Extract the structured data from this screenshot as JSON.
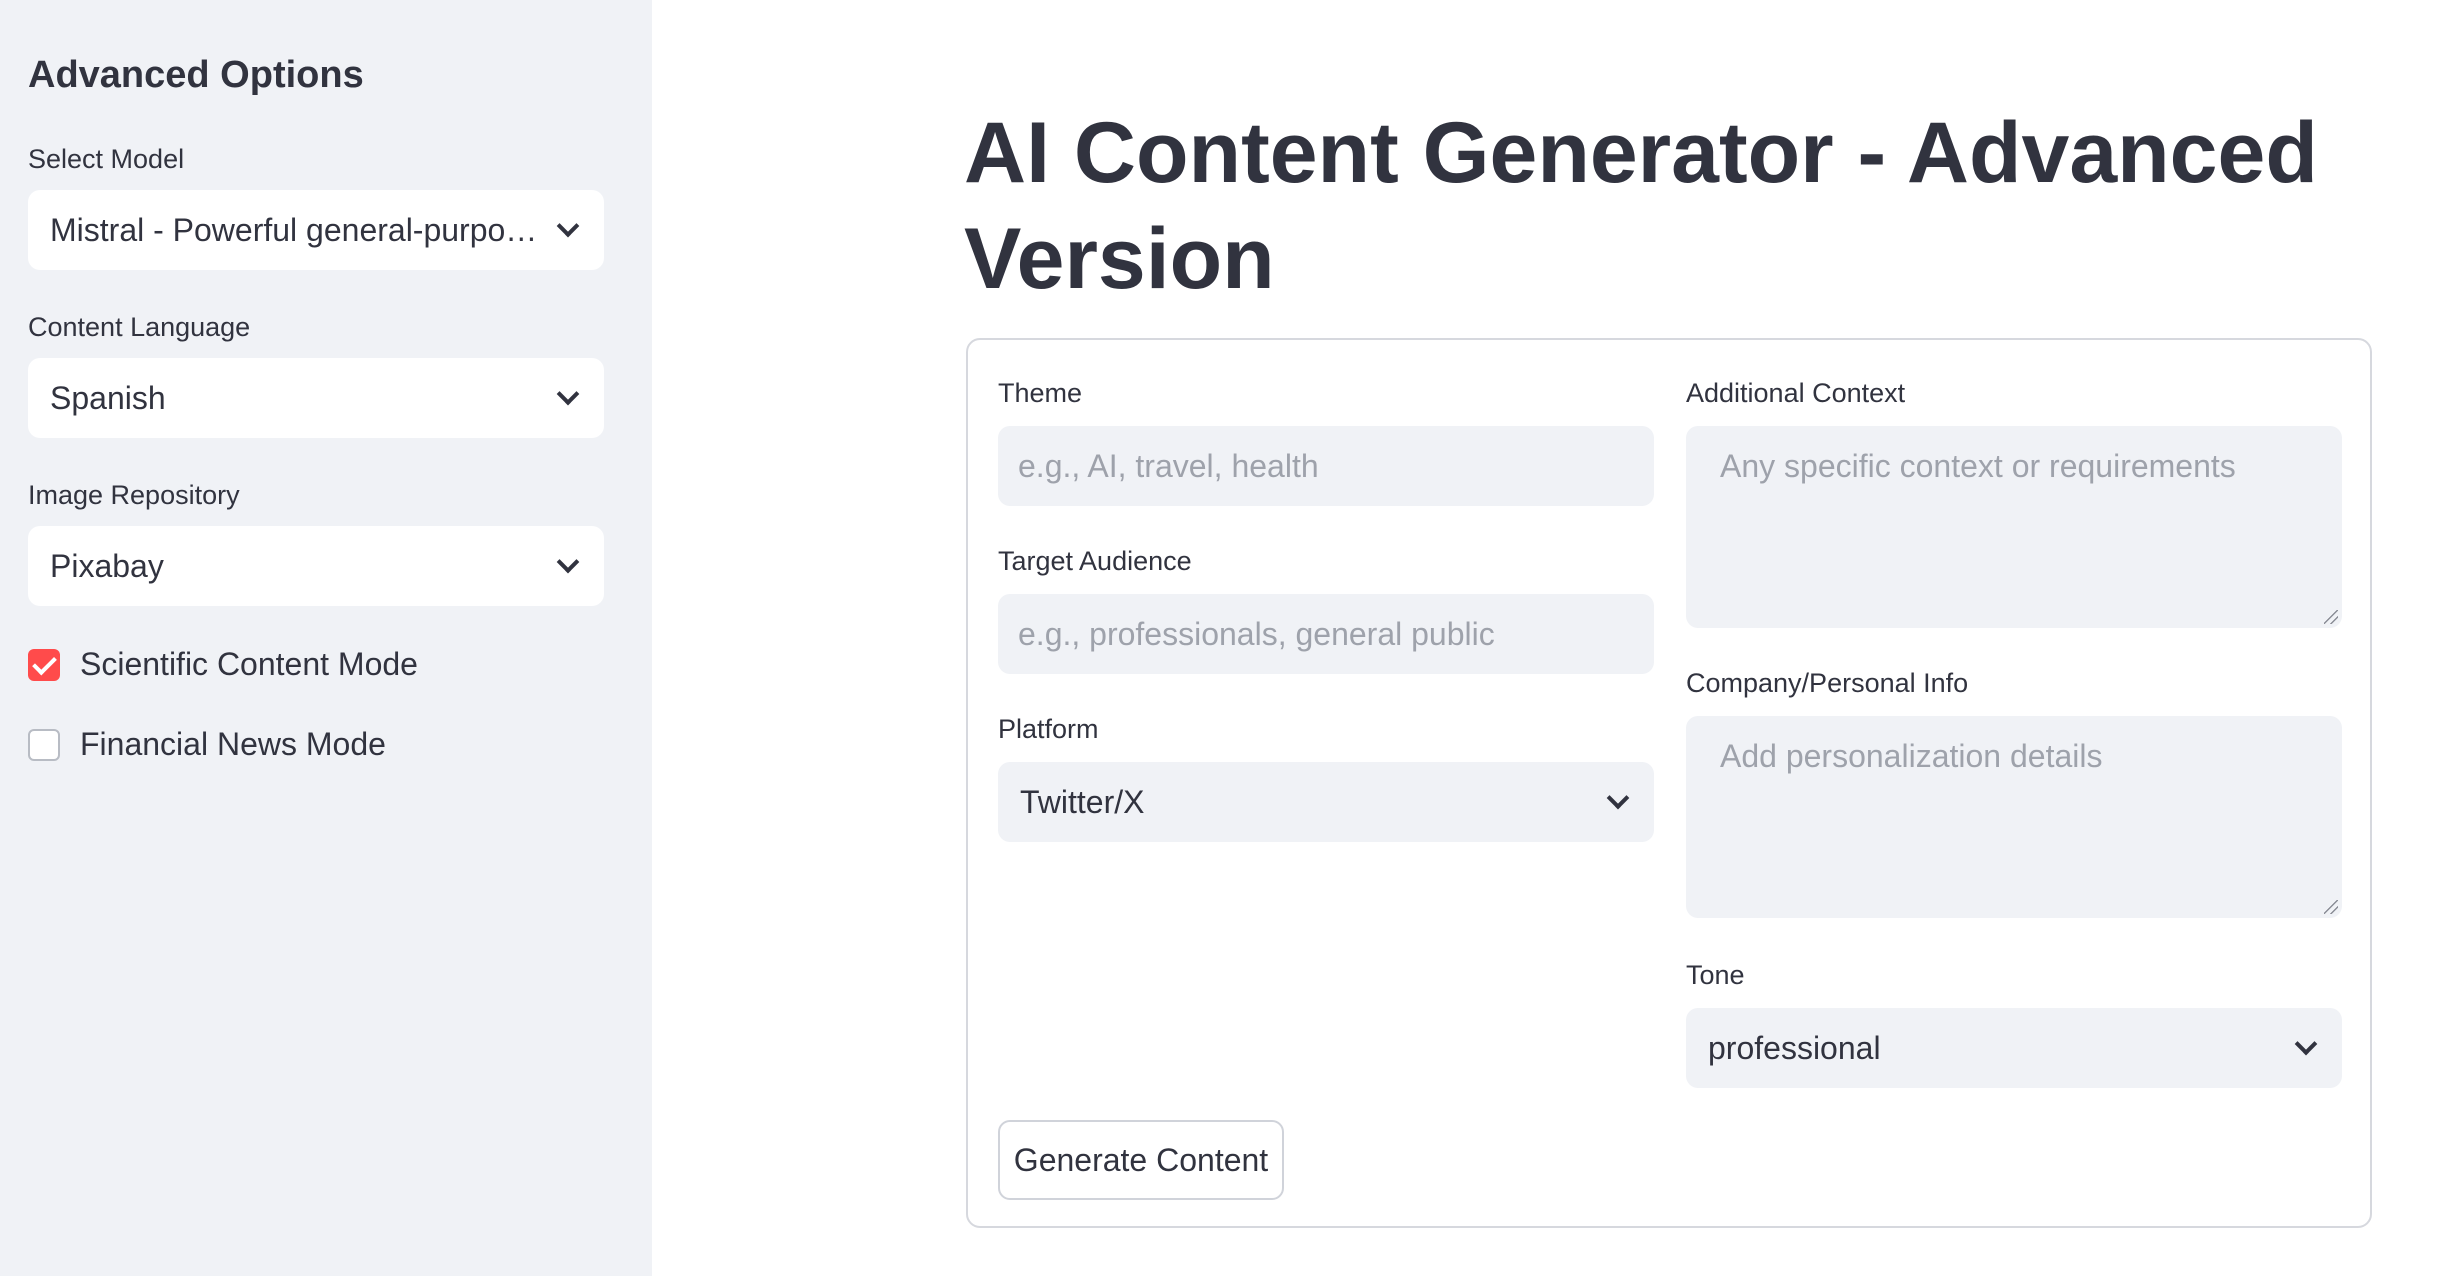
{
  "sidebar": {
    "title": "Advanced Options",
    "model": {
      "label": "Select Model",
      "value": "Mistral - Powerful general-purpose model"
    },
    "language": {
      "label": "Content Language",
      "value": "Spanish"
    },
    "image_repo": {
      "label": "Image Repository",
      "value": "Pixabay"
    },
    "scientific_mode": {
      "label": "Scientific Content Mode",
      "checked": true
    },
    "financial_mode": {
      "label": "Financial News Mode",
      "checked": false
    },
    "accent_color": "#ff4b4b"
  },
  "main": {
    "title": "AI Content Generator - Advanced Version",
    "form": {
      "theme": {
        "label": "Theme",
        "placeholder": "e.g., AI, travel, health"
      },
      "audience": {
        "label": "Target Audience",
        "placeholder": "e.g., professionals, general public"
      },
      "platform": {
        "label": "Platform",
        "value": "Twitter/X"
      },
      "context": {
        "label": "Additional Context",
        "placeholder": "Any specific context or requirements"
      },
      "company": {
        "label": "Company/Personal Info",
        "placeholder": "Add personalization details"
      },
      "tone": {
        "label": "Tone",
        "value": "professional"
      },
      "submit_label": "Generate Content"
    }
  }
}
